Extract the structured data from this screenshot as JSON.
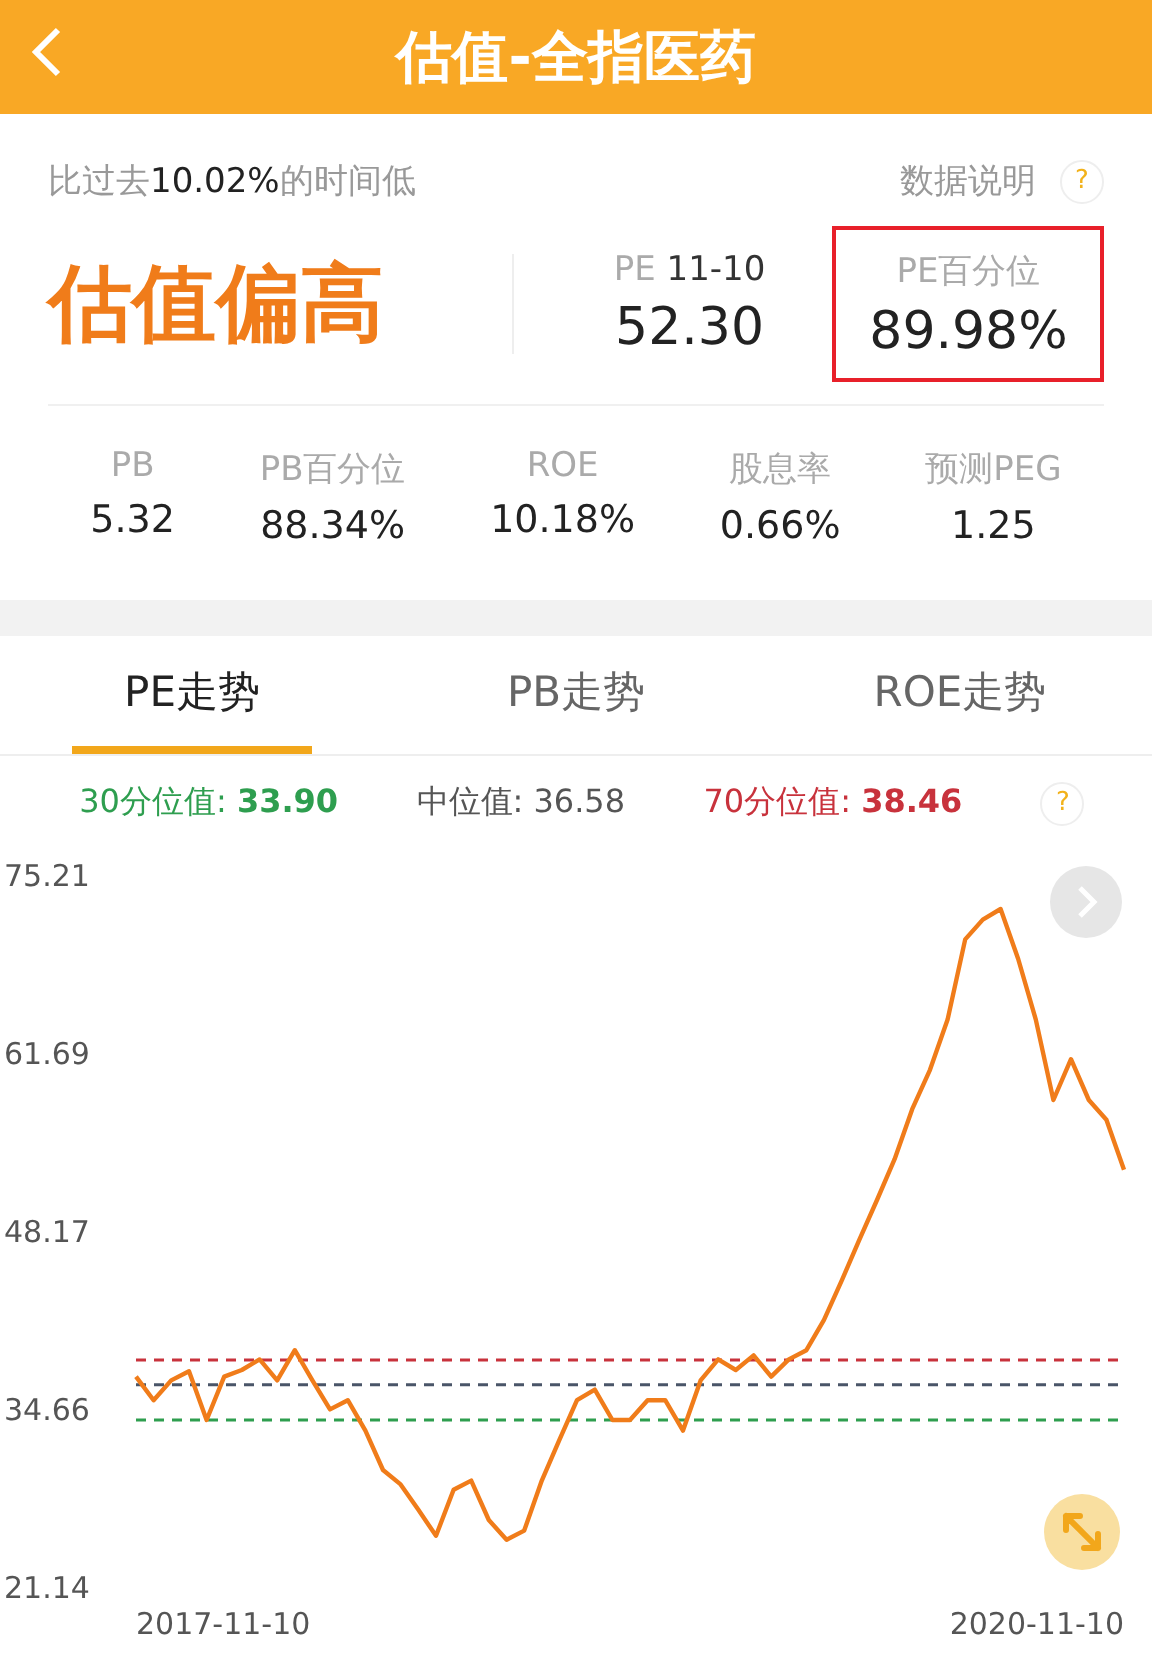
{
  "header": {
    "title": "估值-全指医药"
  },
  "summary": {
    "note": "比过去**10.02%**的时间低",
    "help_link": "数据说明",
    "help_mark": "?",
    "status": "估值偏高"
  },
  "pe": {
    "label": "PE",
    "date": "11-10",
    "value": "52.30"
  },
  "pe_percentile": {
    "label": "PE百分位",
    "value": "89.98%",
    "highlighted": true
  },
  "metrics": [
    {
      "label": "PB",
      "value": "5.32"
    },
    {
      "label": "PB百分位",
      "value": "88.34%"
    },
    {
      "label": "ROE",
      "value": "10.18%"
    },
    {
      "label": "股息率",
      "value": "0.66%"
    },
    {
      "label": "预测PEG",
      "value": "1.25"
    }
  ],
  "tabs": [
    {
      "label": "PE走势",
      "selected": true
    },
    {
      "label": "PB走势",
      "selected": false
    },
    {
      "label": "ROE走势",
      "selected": false
    }
  ],
  "legend_help": "?",
  "chart": {
    "chart_data": {
      "type": "line",
      "ylim": [
        21.14,
        75.21
      ],
      "yticks": [
        21.14,
        34.66,
        48.17,
        61.69,
        75.21
      ],
      "series": [
        {
          "color": "#f07c1a",
          "values": [
            37.2,
            35.4,
            36.9,
            37.6,
            33.9,
            37.2,
            37.7,
            38.5,
            36.9,
            39.2,
            36.9,
            34.7,
            35.4,
            33.1,
            30.1,
            29.0,
            27.1,
            25.1,
            28.6,
            29.3,
            26.3,
            24.8,
            25.5,
            29.3,
            32.4,
            35.4,
            36.2,
            33.9,
            33.9,
            35.4,
            35.4,
            33.1,
            36.9,
            38.5,
            37.7,
            38.8,
            37.2,
            38.5,
            39.2,
            41.5,
            44.5,
            47.6,
            50.6,
            53.7,
            57.5,
            60.5,
            64.3,
            70.4,
            71.9,
            72.7,
            68.9,
            64.3,
            58.2,
            61.3,
            58.2,
            56.7,
            52.9
          ]
        }
      ],
      "ref_lines": [
        {
          "axis": "y",
          "value": 33.9,
          "label": "30分位值: **33.90**",
          "color": "#2e9e4f"
        },
        {
          "axis": "y",
          "value": 36.58,
          "label": "中位值: 36.58",
          "color": "#4a5568"
        },
        {
          "axis": "y",
          "value": 38.46,
          "label": "70分位值: **38.46**",
          "color": "#c8323c"
        }
      ]
    },
    "x_labels": [
      "2017-11-10",
      "2020-11-10"
    ]
  }
}
